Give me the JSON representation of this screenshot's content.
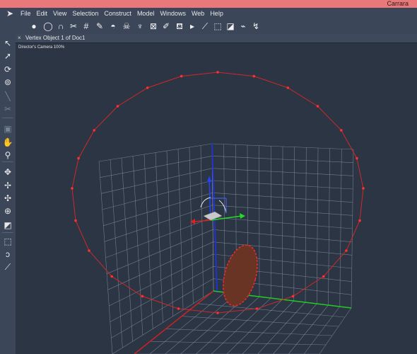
{
  "window": {
    "title": "Carrara"
  },
  "menu": [
    "File",
    "Edit",
    "View",
    "Selection",
    "Construct",
    "Model",
    "Windows",
    "Web",
    "Help"
  ],
  "toolbar": [
    {
      "icon": "sphere-icon",
      "glyph": "●"
    },
    {
      "icon": "circle-icon",
      "glyph": "◯"
    },
    {
      "icon": "magnet-icon",
      "glyph": "∩"
    },
    {
      "icon": "scissors-icon",
      "glyph": "✂"
    },
    {
      "icon": "grid-icon",
      "glyph": "#"
    },
    {
      "icon": "pen-icon",
      "glyph": "✎"
    },
    {
      "icon": "dome-icon",
      "glyph": "◓"
    },
    {
      "icon": "skull-icon",
      "glyph": "☠"
    },
    {
      "icon": "cup-icon",
      "glyph": "♆"
    },
    {
      "icon": "x-box-icon",
      "glyph": "⊠"
    },
    {
      "icon": "brush-icon",
      "glyph": "✐"
    },
    {
      "icon": "paint-bucket-icon",
      "glyph": "⛾"
    },
    {
      "icon": "chevron-icon",
      "glyph": "▸"
    },
    {
      "icon": "wand-icon",
      "glyph": "⟋"
    },
    {
      "icon": "extrude-icon",
      "glyph": "⬚"
    },
    {
      "icon": "lathe-icon",
      "glyph": "◪"
    },
    {
      "icon": "sweep-icon",
      "glyph": "⌁"
    },
    {
      "icon": "bend-icon",
      "glyph": "↯"
    }
  ],
  "left_tools": [
    {
      "icon": "arrow-select-icon",
      "glyph": "↖",
      "dim": false
    },
    {
      "icon": "move-arrow-icon",
      "glyph": "➚",
      "dim": false
    },
    {
      "icon": "rotate-icon",
      "glyph": "⟳",
      "dim": false
    },
    {
      "icon": "scale-icon",
      "glyph": "⊚",
      "dim": false
    },
    {
      "icon": "line-tool-icon",
      "glyph": "╲",
      "dim": true
    },
    {
      "icon": "knife-icon",
      "glyph": "✂",
      "dim": true
    },
    {
      "icon": "camera-icon",
      "glyph": "▣",
      "dim": true
    },
    {
      "icon": "hand-pan-icon",
      "glyph": "✋",
      "dim": false
    },
    {
      "icon": "zoom-icon",
      "glyph": "⚲",
      "dim": false
    },
    {
      "icon": "axis-move-icon",
      "glyph": "✥",
      "dim": false
    },
    {
      "icon": "axis-rotate-icon",
      "glyph": "✢",
      "dim": false
    },
    {
      "icon": "axis-plane-icon",
      "glyph": "✣",
      "dim": false
    },
    {
      "icon": "universal-icon",
      "glyph": "⊕",
      "dim": false
    },
    {
      "icon": "box-select-icon",
      "glyph": "◩",
      "dim": false
    },
    {
      "icon": "marquee-icon",
      "glyph": "⬚",
      "dim": false
    },
    {
      "icon": "lasso-icon",
      "glyph": "ↄ",
      "dim": false
    },
    {
      "icon": "brush-select-icon",
      "glyph": "⟋",
      "dim": false
    }
  ],
  "document": {
    "title": "Vertex Object 1 of Doc1"
  },
  "viewport": {
    "camera_label": "Director's Camera 100%"
  },
  "colors": {
    "title_bar": "#e8787a",
    "background": "#2b3544",
    "grid": "#8a93a3",
    "selection": "#d02828",
    "x_axis": "#22cc22",
    "y_axis": "#2233cc",
    "z_axis": "#cc2222",
    "ellipse_fill": "#6a3424"
  }
}
